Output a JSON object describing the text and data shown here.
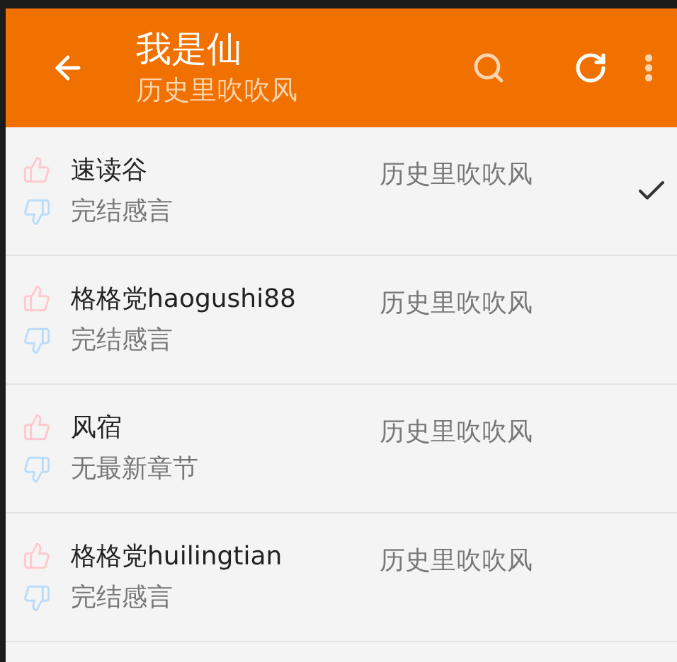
{
  "toolbar": {
    "title": "我是仙",
    "subtitle": "历史里吹吹风"
  },
  "sources": [
    {
      "name": "速读谷",
      "status": "完结感言",
      "book": "历史里吹吹风",
      "selected": true
    },
    {
      "name": "格格党haogushi88",
      "status": "完结感言",
      "book": "历史里吹吹风",
      "selected": false
    },
    {
      "name": "风宿",
      "status": "无最新章节",
      "book": "历史里吹吹风",
      "selected": false
    },
    {
      "name": "格格党huilingtian",
      "status": "完结感言",
      "book": "历史里吹吹风",
      "selected": false
    }
  ]
}
